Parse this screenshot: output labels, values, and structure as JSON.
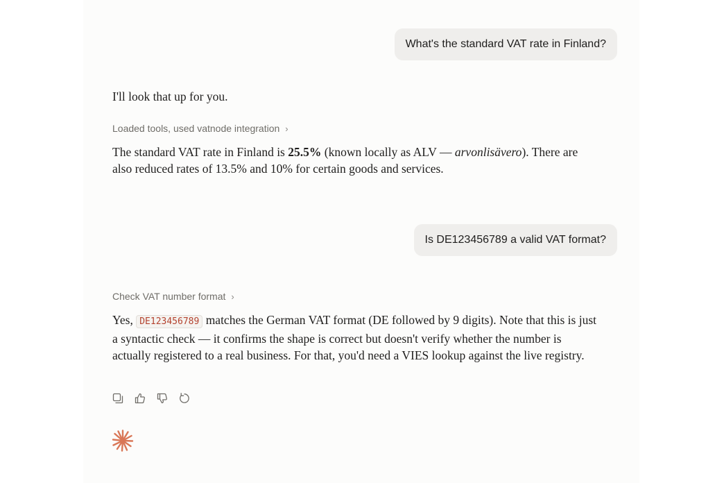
{
  "messages": {
    "user_1": "What's the standard VAT rate in Finland?",
    "assistant_intro": "I'll look that up for you.",
    "tool_1": "Loaded tools, used vatnode integration",
    "answer_1": {
      "pre": "The standard VAT rate in Finland is ",
      "bold": "25.5%",
      "mid": " (known locally as ALV — ",
      "italic": "arvonlisävero",
      "post": "). There are also reduced rates of 13.5% and 10% for certain goods and services."
    },
    "user_2": "Is DE123456789 a valid VAT format?",
    "tool_2": "Check VAT number format",
    "answer_2": {
      "pre": "Yes, ",
      "code": "DE123456789",
      "post": " matches the German VAT format (DE followed by 9 digits). Note that this is just a syntactic check — it confirms the shape is correct but doesn't verify whether the number is actually registered to a real business. For that, you'd need a VIES lookup against the live registry."
    }
  },
  "actions": {
    "icons": [
      "copy-icon",
      "thumbs-up-icon",
      "thumbs-down-icon",
      "retry-icon"
    ]
  },
  "colors": {
    "background": "#ffffff",
    "column": "#fcfcfb",
    "user_bubble": "#efeeec",
    "muted_text": "#6f6d68",
    "code_text": "#b4432f",
    "brand_accent": "#d97757"
  },
  "logo": {
    "icon": "sparkle-logo-icon"
  }
}
